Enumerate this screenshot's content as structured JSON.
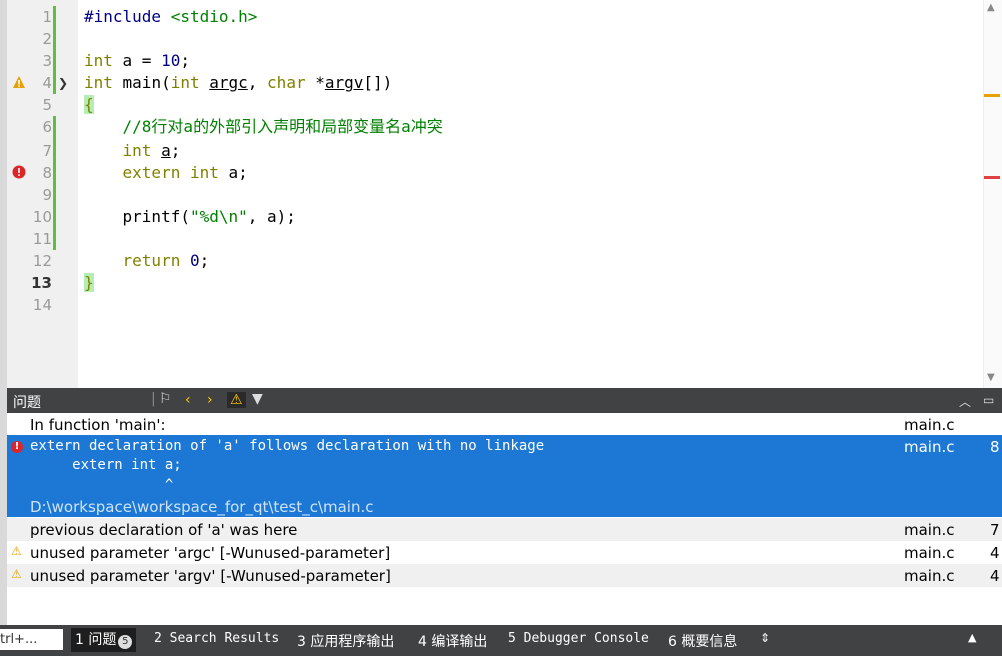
{
  "editor": {
    "line_numbers": [
      "1",
      "2",
      "3",
      "4",
      "5",
      "6",
      "7",
      "8",
      "9",
      "10",
      "11",
      "12",
      "13",
      "14"
    ],
    "current_line": "13",
    "lines": {
      "l1": {
        "pp": "#include",
        "inc": " <stdio.h>"
      },
      "l3": {
        "kw": "int",
        "rest": " a = ",
        "num": "10",
        "end": ";"
      },
      "l4": {
        "kw1": "int",
        "name": " main(",
        "kw2": "int",
        "sp": " ",
        "argc": "argc",
        "comma": ", ",
        "kw3": "char",
        "star": " *",
        "argv": "argv",
        "end": "[])"
      },
      "l5": {
        "brace": "{"
      },
      "l6": {
        "comment": "    //8行对a的外部引入声明和局部变量名a冲突"
      },
      "l7": {
        "indent": "    ",
        "kw": "int",
        "sp": " ",
        "var": "a",
        "end": ";"
      },
      "l8": {
        "indent": "    ",
        "kw1": "extern",
        "sp": " ",
        "kw2": "int",
        "end": " a;"
      },
      "l10": {
        "pre": "    printf(",
        "str": "\"%d\\n\"",
        "end": ", a);"
      },
      "l12": {
        "indent": "    ",
        "kw": "return",
        "sp": " ",
        "num": "0",
        "end": ";"
      },
      "l13": {
        "brace": "}"
      }
    },
    "colors": {
      "keyword": "#808000",
      "string": "#008000",
      "number": "#000080",
      "error": "#d9262b",
      "warning": "#e8a000"
    }
  },
  "issues_pane": {
    "title": "问题"
  },
  "issues": {
    "context": {
      "text": "In function 'main':",
      "file": "main.c"
    },
    "error": {
      "line1": "extern declaration of 'a' follows declaration with no linkage",
      "line2": "     extern int a;",
      "line3": "                ^",
      "path": "D:\\workspace\\workspace_for_qt\\test_c\\main.c",
      "file": "main.c",
      "line": "8"
    },
    "note": {
      "text": "previous declaration of 'a' was here",
      "file": "main.c",
      "line": "7"
    },
    "warn1": {
      "text": "unused parameter 'argc' [-Wunused-parameter]",
      "file": "main.c",
      "line": "4"
    },
    "warn2": {
      "text": "unused parameter 'argv' [-Wunused-parameter]",
      "file": "main.c",
      "line": "4"
    }
  },
  "bottombar": {
    "locator_placeholder": "trl+...",
    "tabs": [
      {
        "label": "1 问题",
        "badge": "5"
      },
      {
        "label": "2 Search Results"
      },
      {
        "label": "3 应用程序输出"
      },
      {
        "label": "4 编译输出"
      },
      {
        "label": "5 Debugger Console"
      },
      {
        "label": "6 概要信息"
      }
    ]
  }
}
